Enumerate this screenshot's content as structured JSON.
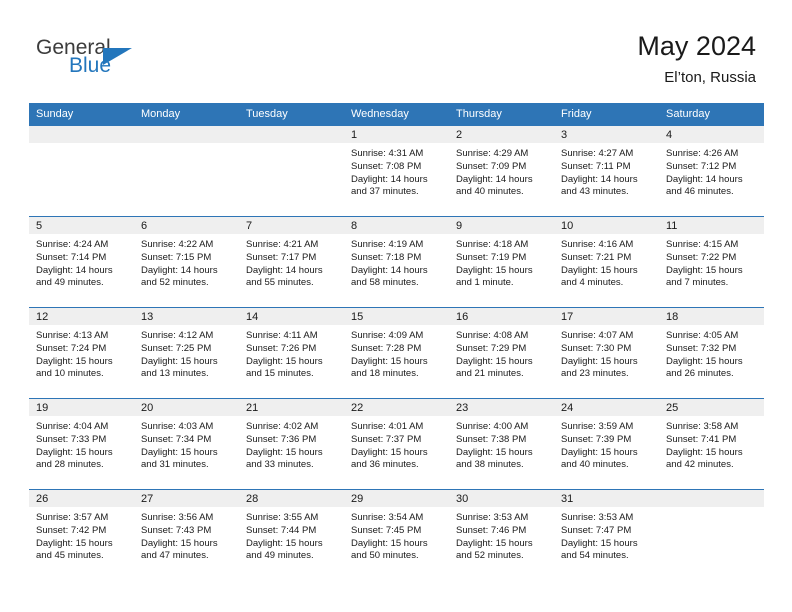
{
  "brand": {
    "name_top": "General",
    "name_bottom": "Blue",
    "accent_color": "#2376bc"
  },
  "header": {
    "title": "May 2024",
    "subtitle": "El’ton, Russia"
  },
  "theme": {
    "header_row_bg": "#2e75b6",
    "date_band_bg": "#efefef",
    "grid_line": "#2e75b6",
    "text": "#1a1a1a"
  },
  "weekday_headers": [
    "Sunday",
    "Monday",
    "Tuesday",
    "Wednesday",
    "Thursday",
    "Friday",
    "Saturday"
  ],
  "labels": {
    "sunrise_prefix": "Sunrise:",
    "sunset_prefix": "Sunset:",
    "daylight_prefix": "Daylight:"
  },
  "weeks": [
    [
      {
        "empty": true
      },
      {
        "empty": true
      },
      {
        "empty": true
      },
      {
        "empty": false,
        "day": "1",
        "sunrise": "Sunrise: 4:31 AM",
        "sunset": "Sunset: 7:08 PM",
        "daylight_1": "Daylight: 14 hours",
        "daylight_2": "and 37 minutes."
      },
      {
        "empty": false,
        "day": "2",
        "sunrise": "Sunrise: 4:29 AM",
        "sunset": "Sunset: 7:09 PM",
        "daylight_1": "Daylight: 14 hours",
        "daylight_2": "and 40 minutes."
      },
      {
        "empty": false,
        "day": "3",
        "sunrise": "Sunrise: 4:27 AM",
        "sunset": "Sunset: 7:11 PM",
        "daylight_1": "Daylight: 14 hours",
        "daylight_2": "and 43 minutes."
      },
      {
        "empty": false,
        "day": "4",
        "sunrise": "Sunrise: 4:26 AM",
        "sunset": "Sunset: 7:12 PM",
        "daylight_1": "Daylight: 14 hours",
        "daylight_2": "and 46 minutes."
      }
    ],
    [
      {
        "empty": false,
        "day": "5",
        "sunrise": "Sunrise: 4:24 AM",
        "sunset": "Sunset: 7:14 PM",
        "daylight_1": "Daylight: 14 hours",
        "daylight_2": "and 49 minutes."
      },
      {
        "empty": false,
        "day": "6",
        "sunrise": "Sunrise: 4:22 AM",
        "sunset": "Sunset: 7:15 PM",
        "daylight_1": "Daylight: 14 hours",
        "daylight_2": "and 52 minutes."
      },
      {
        "empty": false,
        "day": "7",
        "sunrise": "Sunrise: 4:21 AM",
        "sunset": "Sunset: 7:17 PM",
        "daylight_1": "Daylight: 14 hours",
        "daylight_2": "and 55 minutes."
      },
      {
        "empty": false,
        "day": "8",
        "sunrise": "Sunrise: 4:19 AM",
        "sunset": "Sunset: 7:18 PM",
        "daylight_1": "Daylight: 14 hours",
        "daylight_2": "and 58 minutes."
      },
      {
        "empty": false,
        "day": "9",
        "sunrise": "Sunrise: 4:18 AM",
        "sunset": "Sunset: 7:19 PM",
        "daylight_1": "Daylight: 15 hours",
        "daylight_2": "and 1 minute."
      },
      {
        "empty": false,
        "day": "10",
        "sunrise": "Sunrise: 4:16 AM",
        "sunset": "Sunset: 7:21 PM",
        "daylight_1": "Daylight: 15 hours",
        "daylight_2": "and 4 minutes."
      },
      {
        "empty": false,
        "day": "11",
        "sunrise": "Sunrise: 4:15 AM",
        "sunset": "Sunset: 7:22 PM",
        "daylight_1": "Daylight: 15 hours",
        "daylight_2": "and 7 minutes."
      }
    ],
    [
      {
        "empty": false,
        "day": "12",
        "sunrise": "Sunrise: 4:13 AM",
        "sunset": "Sunset: 7:24 PM",
        "daylight_1": "Daylight: 15 hours",
        "daylight_2": "and 10 minutes."
      },
      {
        "empty": false,
        "day": "13",
        "sunrise": "Sunrise: 4:12 AM",
        "sunset": "Sunset: 7:25 PM",
        "daylight_1": "Daylight: 15 hours",
        "daylight_2": "and 13 minutes."
      },
      {
        "empty": false,
        "day": "14",
        "sunrise": "Sunrise: 4:11 AM",
        "sunset": "Sunset: 7:26 PM",
        "daylight_1": "Daylight: 15 hours",
        "daylight_2": "and 15 minutes."
      },
      {
        "empty": false,
        "day": "15",
        "sunrise": "Sunrise: 4:09 AM",
        "sunset": "Sunset: 7:28 PM",
        "daylight_1": "Daylight: 15 hours",
        "daylight_2": "and 18 minutes."
      },
      {
        "empty": false,
        "day": "16",
        "sunrise": "Sunrise: 4:08 AM",
        "sunset": "Sunset: 7:29 PM",
        "daylight_1": "Daylight: 15 hours",
        "daylight_2": "and 21 minutes."
      },
      {
        "empty": false,
        "day": "17",
        "sunrise": "Sunrise: 4:07 AM",
        "sunset": "Sunset: 7:30 PM",
        "daylight_1": "Daylight: 15 hours",
        "daylight_2": "and 23 minutes."
      },
      {
        "empty": false,
        "day": "18",
        "sunrise": "Sunrise: 4:05 AM",
        "sunset": "Sunset: 7:32 PM",
        "daylight_1": "Daylight: 15 hours",
        "daylight_2": "and 26 minutes."
      }
    ],
    [
      {
        "empty": false,
        "day": "19",
        "sunrise": "Sunrise: 4:04 AM",
        "sunset": "Sunset: 7:33 PM",
        "daylight_1": "Daylight: 15 hours",
        "daylight_2": "and 28 minutes."
      },
      {
        "empty": false,
        "day": "20",
        "sunrise": "Sunrise: 4:03 AM",
        "sunset": "Sunset: 7:34 PM",
        "daylight_1": "Daylight: 15 hours",
        "daylight_2": "and 31 minutes."
      },
      {
        "empty": false,
        "day": "21",
        "sunrise": "Sunrise: 4:02 AM",
        "sunset": "Sunset: 7:36 PM",
        "daylight_1": "Daylight: 15 hours",
        "daylight_2": "and 33 minutes."
      },
      {
        "empty": false,
        "day": "22",
        "sunrise": "Sunrise: 4:01 AM",
        "sunset": "Sunset: 7:37 PM",
        "daylight_1": "Daylight: 15 hours",
        "daylight_2": "and 36 minutes."
      },
      {
        "empty": false,
        "day": "23",
        "sunrise": "Sunrise: 4:00 AM",
        "sunset": "Sunset: 7:38 PM",
        "daylight_1": "Daylight: 15 hours",
        "daylight_2": "and 38 minutes."
      },
      {
        "empty": false,
        "day": "24",
        "sunrise": "Sunrise: 3:59 AM",
        "sunset": "Sunset: 7:39 PM",
        "daylight_1": "Daylight: 15 hours",
        "daylight_2": "and 40 minutes."
      },
      {
        "empty": false,
        "day": "25",
        "sunrise": "Sunrise: 3:58 AM",
        "sunset": "Sunset: 7:41 PM",
        "daylight_1": "Daylight: 15 hours",
        "daylight_2": "and 42 minutes."
      }
    ],
    [
      {
        "empty": false,
        "day": "26",
        "sunrise": "Sunrise: 3:57 AM",
        "sunset": "Sunset: 7:42 PM",
        "daylight_1": "Daylight: 15 hours",
        "daylight_2": "and 45 minutes."
      },
      {
        "empty": false,
        "day": "27",
        "sunrise": "Sunrise: 3:56 AM",
        "sunset": "Sunset: 7:43 PM",
        "daylight_1": "Daylight: 15 hours",
        "daylight_2": "and 47 minutes."
      },
      {
        "empty": false,
        "day": "28",
        "sunrise": "Sunrise: 3:55 AM",
        "sunset": "Sunset: 7:44 PM",
        "daylight_1": "Daylight: 15 hours",
        "daylight_2": "and 49 minutes."
      },
      {
        "empty": false,
        "day": "29",
        "sunrise": "Sunrise: 3:54 AM",
        "sunset": "Sunset: 7:45 PM",
        "daylight_1": "Daylight: 15 hours",
        "daylight_2": "and 50 minutes."
      },
      {
        "empty": false,
        "day": "30",
        "sunrise": "Sunrise: 3:53 AM",
        "sunset": "Sunset: 7:46 PM",
        "daylight_1": "Daylight: 15 hours",
        "daylight_2": "and 52 minutes."
      },
      {
        "empty": false,
        "day": "31",
        "sunrise": "Sunrise: 3:53 AM",
        "sunset": "Sunset: 7:47 PM",
        "daylight_1": "Daylight: 15 hours",
        "daylight_2": "and 54 minutes."
      },
      {
        "empty": true
      }
    ]
  ]
}
